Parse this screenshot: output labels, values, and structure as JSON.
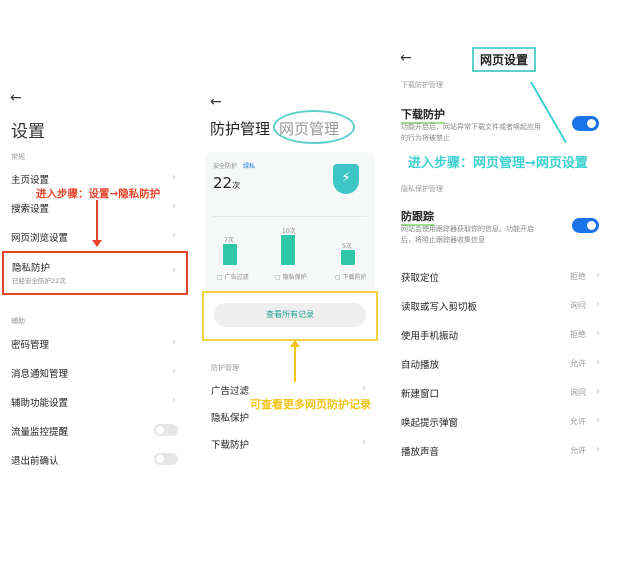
{
  "panel1": {
    "title": "设置",
    "section1": "常规",
    "items": [
      {
        "label": "主页设置"
      },
      {
        "label": "搜索设置"
      },
      {
        "label": "网页浏览设置"
      },
      {
        "label": "隐私防护",
        "sub": "已经安全防护22次"
      }
    ],
    "section2": "辅助",
    "items2": [
      {
        "label": "密码管理"
      },
      {
        "label": "消息通知管理"
      },
      {
        "label": "辅助功能设置"
      },
      {
        "label": "流量监控提醒",
        "toggle": false
      },
      {
        "label": "退出前确认",
        "toggle": false
      }
    ],
    "annotation": "进入步骤：设置→隐私防护"
  },
  "panel2": {
    "tab_active": "防护管理",
    "tab_other": "网页管理",
    "card": {
      "label": "安全防护",
      "badge": "绿私",
      "count": "22",
      "unit": "次",
      "bars": [
        {
          "label": "广告过滤",
          "value": 7,
          "value_label": "7次"
        },
        {
          "label": "隐私保护",
          "value": 10,
          "value_label": "10次"
        },
        {
          "label": "下载防护",
          "value": 5,
          "value_label": "5次"
        }
      ]
    },
    "view_all": "查看所有记录",
    "section": "防护管理",
    "items": [
      "广告过滤",
      "隐私保护",
      "下载防护"
    ],
    "annotation": "可查看更多网页防护记录"
  },
  "panel3": {
    "title": "网页设置",
    "section1": "下载防护管理",
    "download": {
      "label": "下载防护",
      "desc1": "功能开启后，网站异常下载文件或者唤起应用",
      "desc2": "的行为将被禁止",
      "on": true
    },
    "section2": "隐私保护管理",
    "tracking": {
      "label": "防跟踪",
      "desc1": "网站会使用跟踪器获取你的信息。功能开启",
      "desc2": "后，将阻止跟踪器收集信息",
      "on": true
    },
    "perms": [
      {
        "label": "获取定位",
        "value": "拒绝"
      },
      {
        "label": "读取或写入剪切板",
        "value": "询问"
      },
      {
        "label": "使用手机振动",
        "value": "拒绝"
      },
      {
        "label": "自动播放",
        "value": "允许"
      },
      {
        "label": "新建窗口",
        "value": "询问"
      },
      {
        "label": "唤起提示弹窗",
        "value": "允许"
      },
      {
        "label": "播放声音",
        "value": "允许"
      }
    ],
    "annotation": "进入步骤：网页管理→网页设置"
  },
  "colors": {
    "accent": "#1a73e8",
    "teal": "#2fc8a8",
    "red": "#e8452c",
    "cyan": "#3ed1d1",
    "yellow": "#f0c419"
  }
}
